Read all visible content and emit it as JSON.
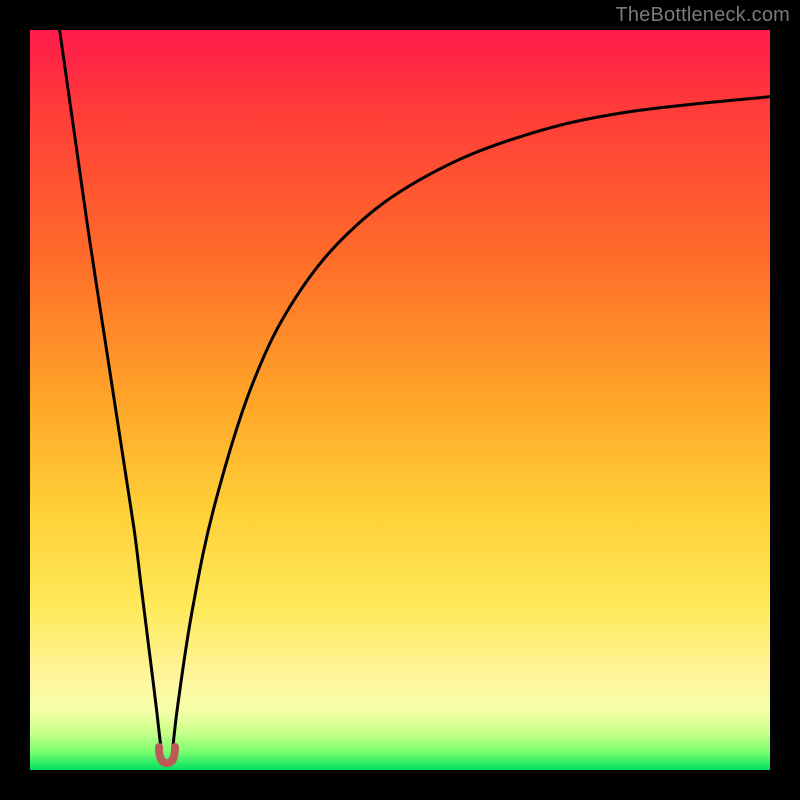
{
  "watermark": {
    "text": "TheBottleneck.com"
  },
  "colors": {
    "curve_stroke": "#000000",
    "dip_marker": "#bb5a56",
    "gradient": [
      "#ff1a4b",
      "#ff6a2a",
      "#ffd038",
      "#fff6a0",
      "#00e060"
    ]
  },
  "chart_data": {
    "type": "line",
    "title": "",
    "xlabel": "",
    "ylabel": "",
    "xlim": [
      0,
      100
    ],
    "ylim": [
      0,
      100
    ],
    "annotations": [
      {
        "kind": "dip-marker",
        "x": 18.5,
        "y": 2,
        "color": "#bb5a56"
      }
    ],
    "series": [
      {
        "name": "left-branch",
        "x": [
          4.0,
          6.0,
          8.0,
          10.0,
          12.0,
          14.0,
          15.0,
          16.0,
          17.0,
          17.8
        ],
        "values": [
          100,
          86.0,
          72.0,
          59.0,
          46.0,
          33.0,
          25.0,
          17.0,
          9.0,
          2.0
        ]
      },
      {
        "name": "right-branch",
        "x": [
          19.2,
          20.0,
          22.0,
          25.0,
          30.0,
          36.0,
          44.0,
          54.0,
          66.0,
          80.0,
          100.0
        ],
        "values": [
          2.0,
          9.0,
          22.0,
          36.0,
          52.0,
          64.0,
          73.5,
          80.5,
          85.5,
          88.8,
          91.0
        ]
      }
    ]
  }
}
